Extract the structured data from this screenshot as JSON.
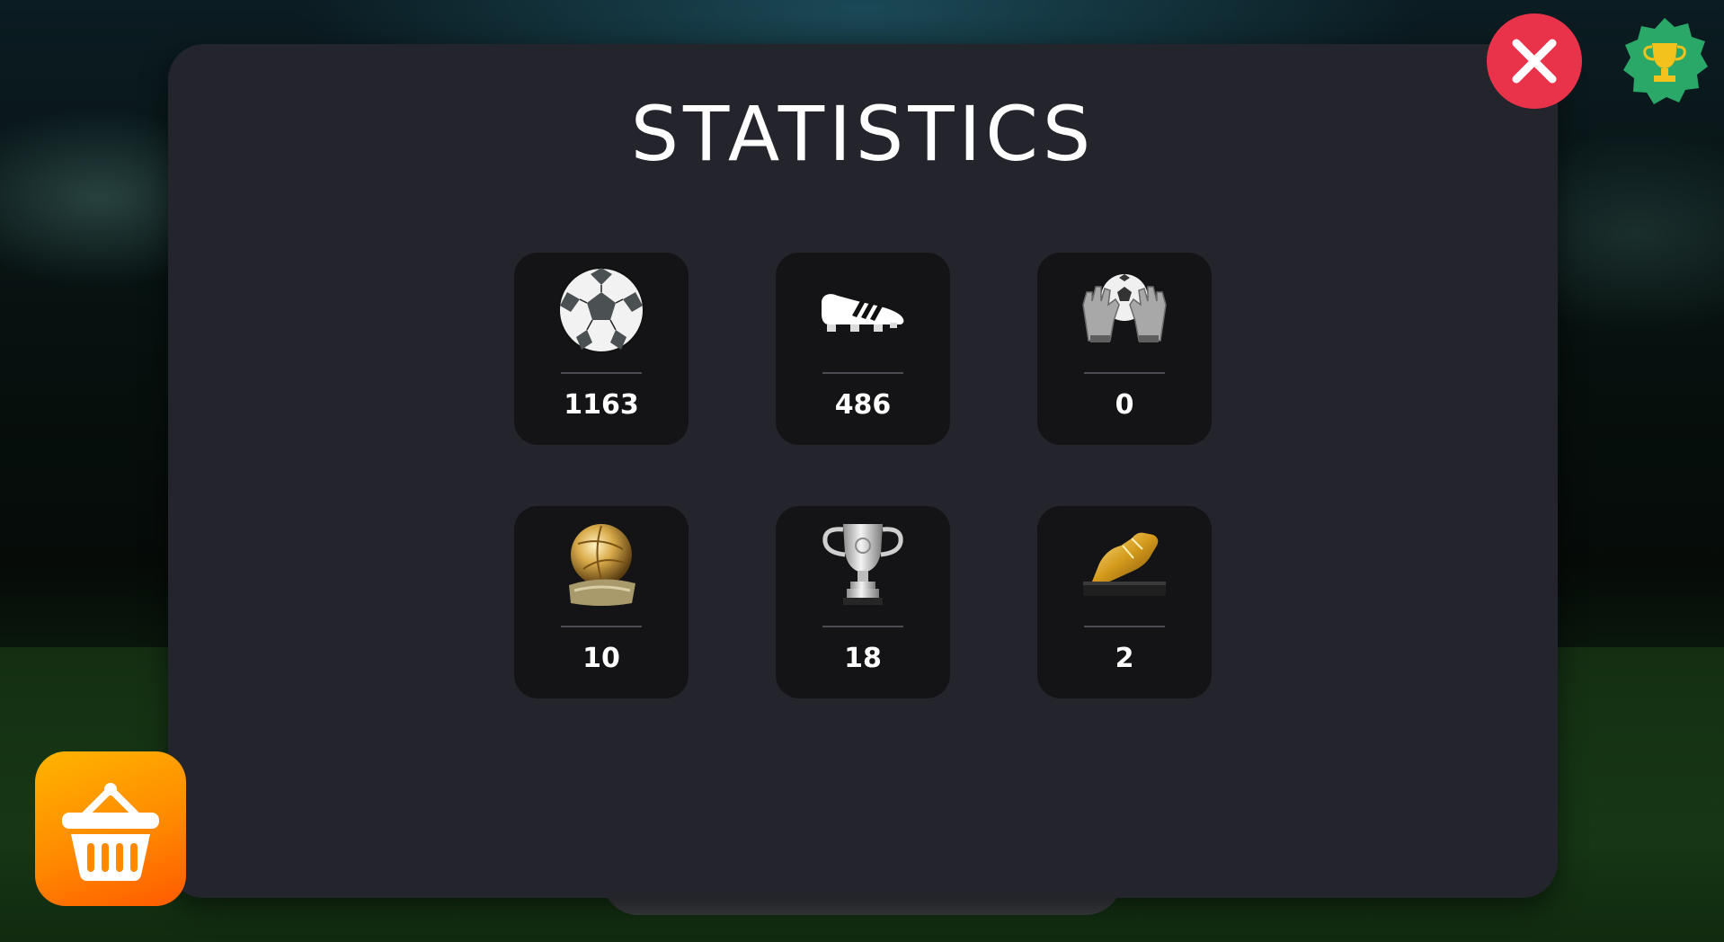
{
  "screen": {
    "title": "STATISTICS"
  },
  "stats": [
    {
      "icon": "soccer-ball-icon",
      "value": "1163"
    },
    {
      "icon": "football-boot-icon",
      "value": "486"
    },
    {
      "icon": "goalkeeper-gloves-icon",
      "value": "0"
    },
    {
      "icon": "golden-ball-trophy-icon",
      "value": "10"
    },
    {
      "icon": "silver-cup-trophy-icon",
      "value": "18"
    },
    {
      "icon": "golden-boot-trophy-icon",
      "value": "2"
    }
  ],
  "buttons": {
    "close_icon": "close-icon",
    "achievements_icon": "trophy-icon",
    "shop_icon": "shopping-basket-icon"
  },
  "colors": {
    "panel": "#24252c",
    "card": "#141416",
    "close": "#e8334a",
    "badge": "#2aa868",
    "shop": "#ff8a00"
  }
}
